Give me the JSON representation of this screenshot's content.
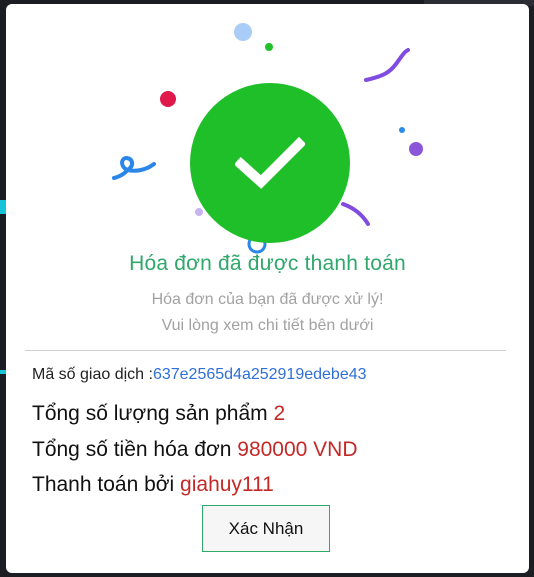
{
  "modal": {
    "title": "Hóa đơn đã được thanh toán",
    "subtitle_line1": "Hóa đơn của bạn đã được xử lý!",
    "subtitle_line2": "Vui lòng xem chi tiết bên dưới",
    "transaction": {
      "label": "Mã số giao dịch :",
      "id": "637e2565d4a252919edebe43"
    },
    "quantity": {
      "label": "Tổng số lượng sản phẩm",
      "value": "2"
    },
    "total": {
      "label": "Tổng số tiền hóa đơn",
      "value": "980000 VND"
    },
    "paid_by": {
      "label": "Thanh toán bởi",
      "value": "giahuy111"
    },
    "confirm_label": "Xác Nhận",
    "icon": "check-circle-icon"
  },
  "colors": {
    "success": "#1fbf2a",
    "title_green": "#2fa86a",
    "highlight_red": "#c62828",
    "link_blue": "#2f6fd8"
  }
}
